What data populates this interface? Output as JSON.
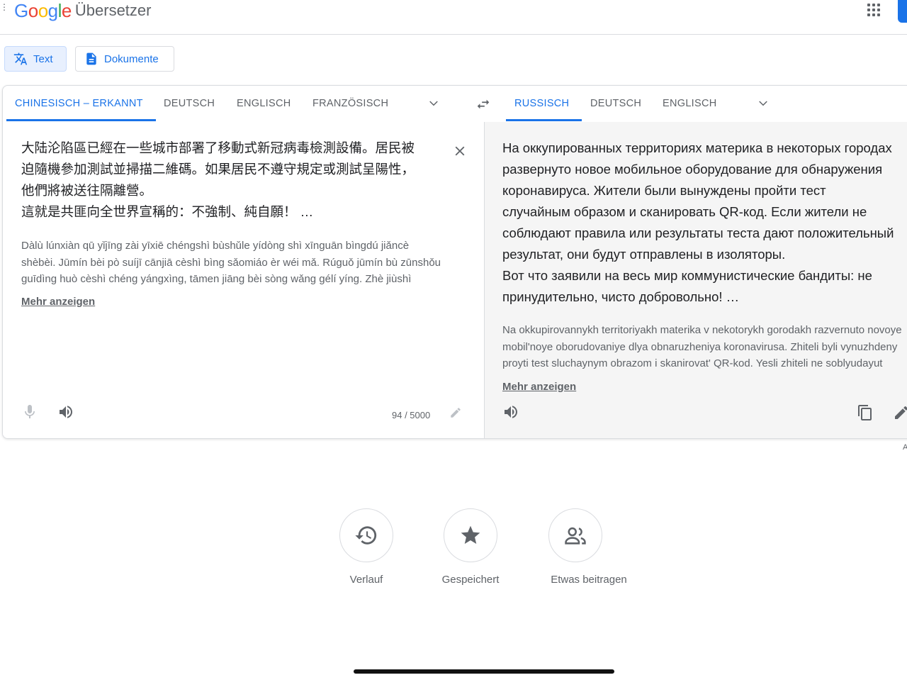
{
  "app": {
    "logo_google": "Google",
    "logo_product": "Übersetzer"
  },
  "modes": {
    "text_label": "Text",
    "documents_label": "Dokumente"
  },
  "source_languages": [
    "CHINESISCH – ERKANNT",
    "DEUTSCH",
    "ENGLISCH",
    "FRANZÖSISCH"
  ],
  "target_languages": [
    "RUSSISCH",
    "DEUTSCH",
    "ENGLISCH"
  ],
  "source": {
    "lines": [
      "大陆沦陷區已經在一些城市部署了移動式新冠病毒檢測設備。居民被",
      "迫隨機參加測試並掃描二維碼。如果居民不遵守規定或測試呈陽性，",
      "他們將被送往隔離營。",
      "這就是共匪向全世界宣稱的：不強制、純自願！ …"
    ],
    "transliteration": [
      "Dàlù lúnxiàn qū yǐjīng zài yīxiē chéngshì bùshǔle yídòng shì xīnguān bìngdú jiǎncè",
      "shèbèi. Jūmín bèi pò suíjī cānjiā cèshì bìng sǎomiáo èr wéi mǎ. Rúguǒ jūmín bù zūnshǒu",
      "guīdìng huò cèshì chéng yángxìng, tāmen jiāng bèi sòng wǎng gélí yíng. Zhè jiùshì"
    ],
    "show_more": "Mehr anzeigen",
    "char_count": "94 / 5000"
  },
  "target": {
    "lines": [
      "На оккупированных территориях материка в некоторых городах",
      "развернуто новое мобильное оборудование для обнаружения",
      "коронавируса. Жители были вынуждены пройти тест",
      "случайным образом и сканировать QR-код. Если жители не",
      "соблюдают правила или результаты теста дают положительный",
      "результат, они будут отправлены в изоляторы.",
      "Вот что заявили на весь мир коммунистические бандиты: не",
      "принудительно, чисто добровольно! …"
    ],
    "transliteration": [
      "Na okkupirovannykh territoriyakh materika v nekotorykh gorodakh razvernuto novoye",
      "mobil'noye oborudovaniye dlya obnaruzheniya koronavirusa. Zhiteli byli vynuzhdeny",
      "proyti test sluchaynym obrazom i skanirovat' QR-kod. Yesli zhiteli ne soblyudayut"
    ],
    "show_more": "Mehr anzeigen"
  },
  "bottom": {
    "history": "Verlauf",
    "saved": "Gespeichert",
    "contribute": "Etwas beitragen"
  },
  "colors": {
    "accent": "#1a73e8",
    "text": "#202124",
    "muted": "#5f6368",
    "border": "#dadce0",
    "target_bg": "#f5f5f5"
  }
}
